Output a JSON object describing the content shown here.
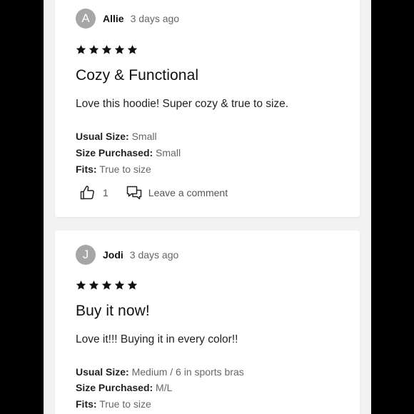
{
  "reviews": [
    {
      "avatar_letter": "A",
      "author": "Allie",
      "date": "3 days ago",
      "rating": 5,
      "title": "Cozy & Functional",
      "body": "Love this hoodie! Super cozy & true to size.",
      "attributes": [
        {
          "label": "Usual Size:",
          "value": "Small"
        },
        {
          "label": "Size Purchased:",
          "value": "Small"
        },
        {
          "label": "Fits:",
          "value": "True to size"
        }
      ],
      "likes": "1",
      "comment_label": "Leave a comment"
    },
    {
      "avatar_letter": "J",
      "author": "Jodi",
      "date": "3 days ago",
      "rating": 5,
      "title": "Buy it now!",
      "body": "Love it!!! Buying it in every color!!",
      "attributes": [
        {
          "label": "Usual Size:",
          "value": "Medium / 6 in sports bras"
        },
        {
          "label": "Size Purchased:",
          "value": "M/L"
        },
        {
          "label": "Fits:",
          "value": "True to size"
        }
      ]
    }
  ],
  "icons": {
    "star": "star-icon",
    "like": "thumbs-up-icon",
    "comment": "comment-icon"
  }
}
